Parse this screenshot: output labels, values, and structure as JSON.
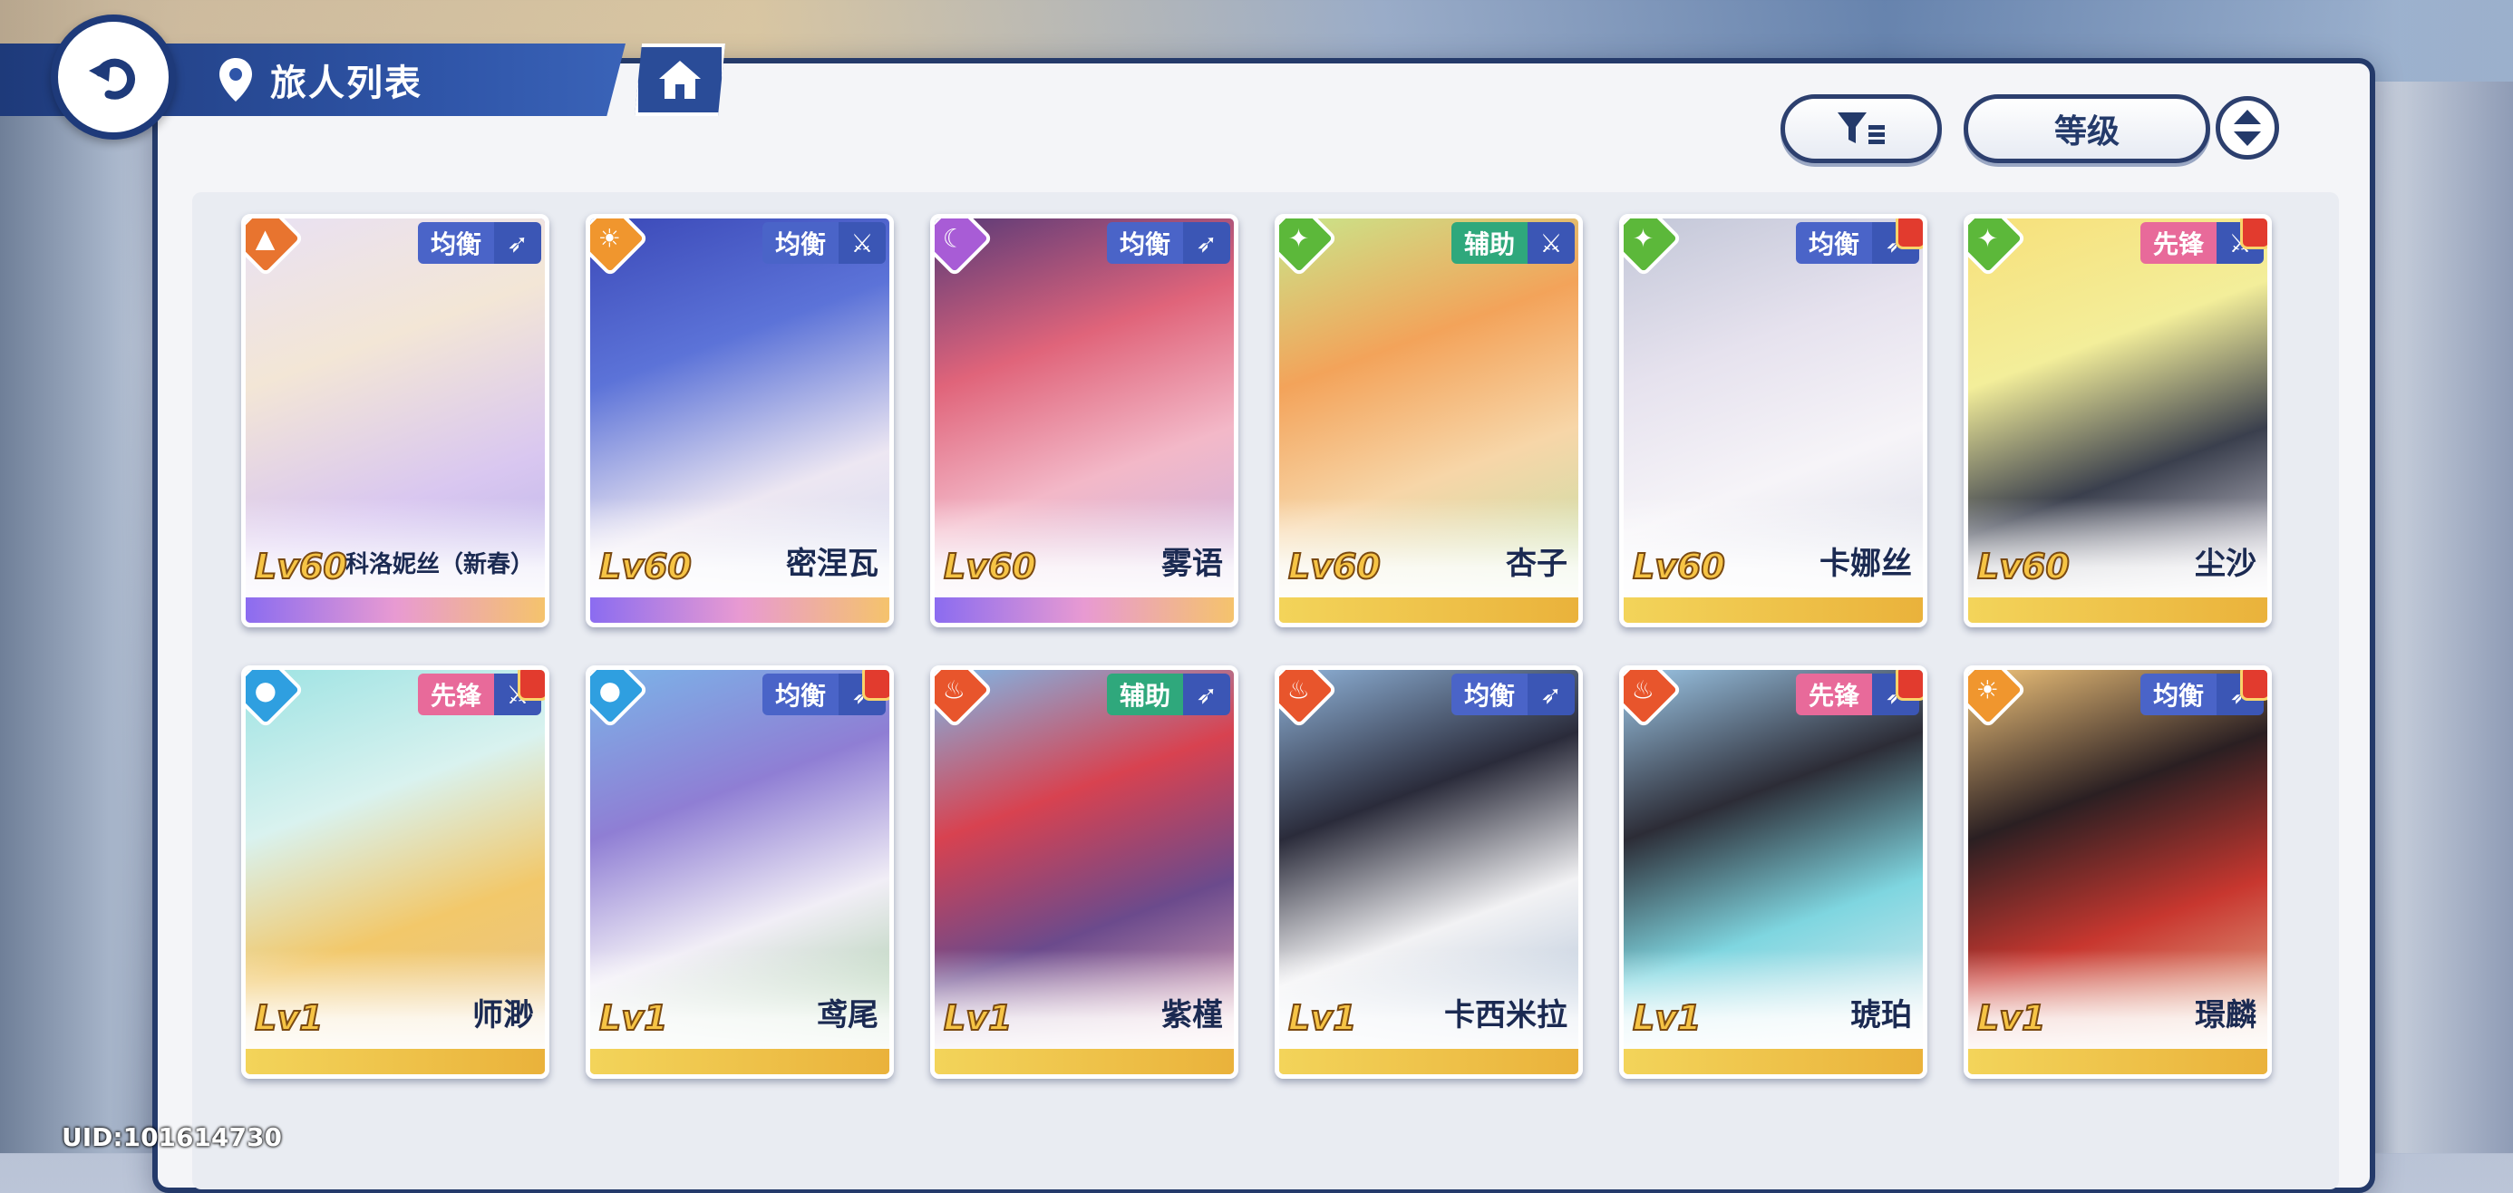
{
  "header": {
    "title": "旅人列表",
    "back_icon": "back-arrow-icon",
    "location_icon": "location-pin-icon",
    "home_icon": "home-icon"
  },
  "toolbar": {
    "filter_icon": "filter-icon",
    "sort_label": "等级",
    "order_icon": "sort-order-icon"
  },
  "colors": {
    "navy": "#243a6a",
    "fire": "#e8552c",
    "water": "#2f9fe0",
    "wind": "#5cb83a",
    "light": "#f0962e",
    "dark": "#a85cd6",
    "earth": "#e8742f"
  },
  "cards": [
    {
      "name": "科洛妮丝（新春）",
      "level": "Lv60",
      "role": "均衡",
      "element": "earth",
      "weapon": "bow"
    },
    {
      "name": "密涅瓦",
      "level": "Lv60",
      "role": "均衡",
      "element": "light",
      "weapon": "sword"
    },
    {
      "name": "雾语",
      "level": "Lv60",
      "role": "均衡",
      "element": "dark",
      "weapon": "bow"
    },
    {
      "name": "杏子",
      "level": "Lv60",
      "role": "辅助",
      "element": "wind",
      "weapon": "sword"
    },
    {
      "name": "卡娜丝",
      "level": "Lv60",
      "role": "均衡",
      "element": "wind",
      "weapon": "bow"
    },
    {
      "name": "尘沙",
      "level": "Lv60",
      "role": "先锋",
      "element": "wind",
      "weapon": "sword"
    },
    {
      "name": "师渺",
      "level": "Lv1",
      "role": "先锋",
      "element": "water",
      "weapon": "sword"
    },
    {
      "name": "鸢尾",
      "level": "Lv1",
      "role": "均衡",
      "element": "water",
      "weapon": "bow"
    },
    {
      "name": "紫槿",
      "level": "Lv1",
      "role": "辅助",
      "element": "fire",
      "weapon": "bow"
    },
    {
      "name": "卡西米拉",
      "level": "Lv1",
      "role": "均衡",
      "element": "fire",
      "weapon": "bow"
    },
    {
      "name": "琥珀",
      "level": "Lv1",
      "role": "先锋",
      "element": "fire",
      "weapon": "bow"
    },
    {
      "name": "璟麟",
      "level": "Lv1",
      "role": "均衡",
      "element": "light",
      "weapon": "bow"
    }
  ],
  "footer": {
    "uid": "UID:101614730"
  }
}
